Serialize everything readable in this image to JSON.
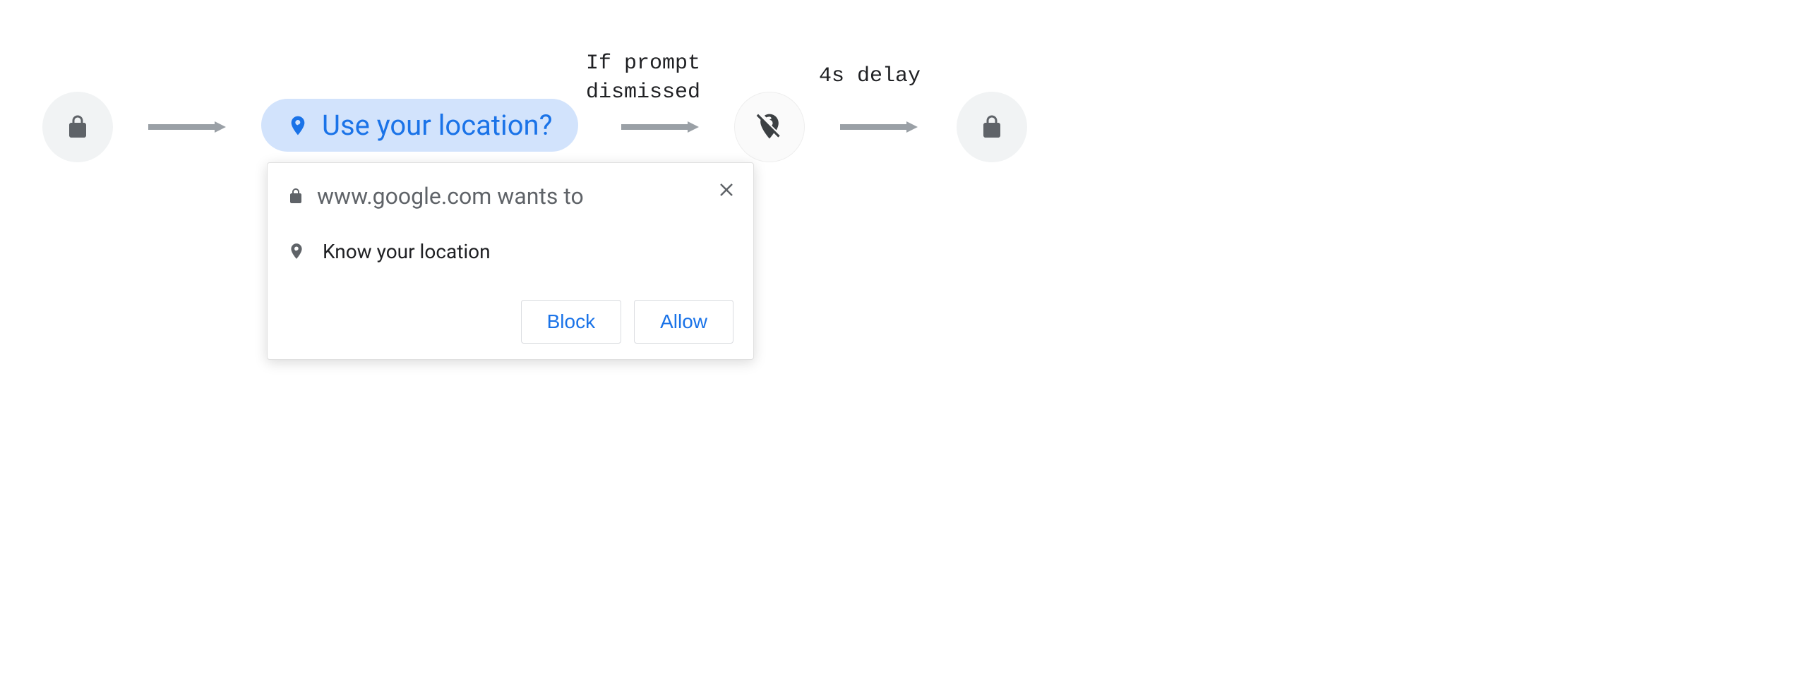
{
  "captions": {
    "dismissed": "If prompt\ndismissed",
    "delay": "4s delay"
  },
  "chip": {
    "label": "Use your location?"
  },
  "prompt": {
    "header": "www.google.com wants to",
    "permission": "Know your location",
    "block_label": "Block",
    "allow_label": "Allow"
  }
}
